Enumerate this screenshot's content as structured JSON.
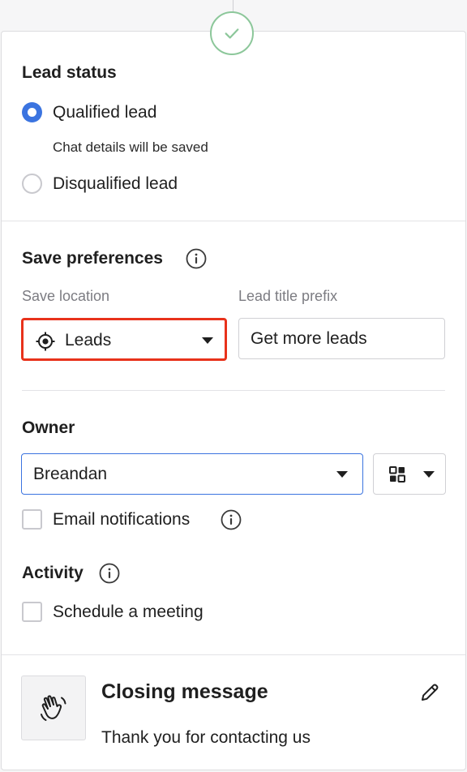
{
  "lead_status": {
    "heading": "Lead status",
    "qualified_label": "Qualified lead",
    "qualified_note": "Chat details will be saved",
    "disqualified_label": "Disqualified lead",
    "selected": "qualified"
  },
  "save_preferences": {
    "heading": "Save preferences",
    "save_location_label": "Save location",
    "save_location_value": "Leads",
    "lead_title_prefix_label": "Lead title prefix",
    "lead_title_prefix_value": "Get more leads"
  },
  "owner": {
    "heading": "Owner",
    "selected": "Breandan",
    "email_notifications_label": "Email notifications",
    "email_notifications_checked": false
  },
  "activity": {
    "heading": "Activity",
    "schedule_meeting_label": "Schedule a meeting",
    "schedule_meeting_checked": false
  },
  "closing": {
    "heading": "Closing message",
    "message": "Thank you for contacting us"
  },
  "colors": {
    "accent": "#3b74e0",
    "highlight": "#e8321b",
    "success": "#8cc79a"
  },
  "icons": [
    "check-icon",
    "info-icon",
    "target-icon",
    "chevron-down-icon",
    "grid-icon",
    "waving-hand-icon",
    "pencil-icon"
  ]
}
